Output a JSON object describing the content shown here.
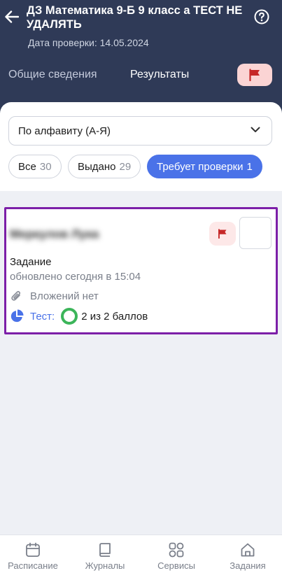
{
  "header": {
    "title": "ДЗ Математика 9-Б 9 класс а ТЕСТ НЕ УДАЛЯТЬ",
    "check_date": "Дата проверки: 14.05.2024",
    "tabs": [
      {
        "label": "Общие сведения",
        "active": false
      },
      {
        "label": "Результаты",
        "active": true
      }
    ],
    "icons": {
      "back": "arrow-left-icon",
      "help": "help-circle-icon",
      "flag": "flag-icon"
    },
    "bg_color": "#2f3a57"
  },
  "filters": {
    "sort_value": "По алфавиту (А-Я)",
    "chips": [
      {
        "label": "Все",
        "count": "30",
        "active": false
      },
      {
        "label": "Выдано",
        "count": "29",
        "active": false
      },
      {
        "label": "Требует проверки",
        "count": "1",
        "active": true
      }
    ],
    "accent_color": "#4a72e8"
  },
  "card": {
    "student_name": "Меркулов Лука",
    "task_label": "Задание",
    "updated": "обновлено сегодня в 15:04",
    "attachments": "Вложений нет",
    "test_label": "Тест:",
    "score": "2 из 2 баллов",
    "highlight_color": "#7c1fa8",
    "score_color": "#3cb55a"
  },
  "bottom_nav": {
    "items": [
      {
        "label": "Расписание",
        "icon": "calendar-icon"
      },
      {
        "label": "Журналы",
        "icon": "book-icon"
      },
      {
        "label": "Сервисы",
        "icon": "grid-icon"
      },
      {
        "label": "Задания",
        "icon": "home-icon"
      }
    ]
  }
}
